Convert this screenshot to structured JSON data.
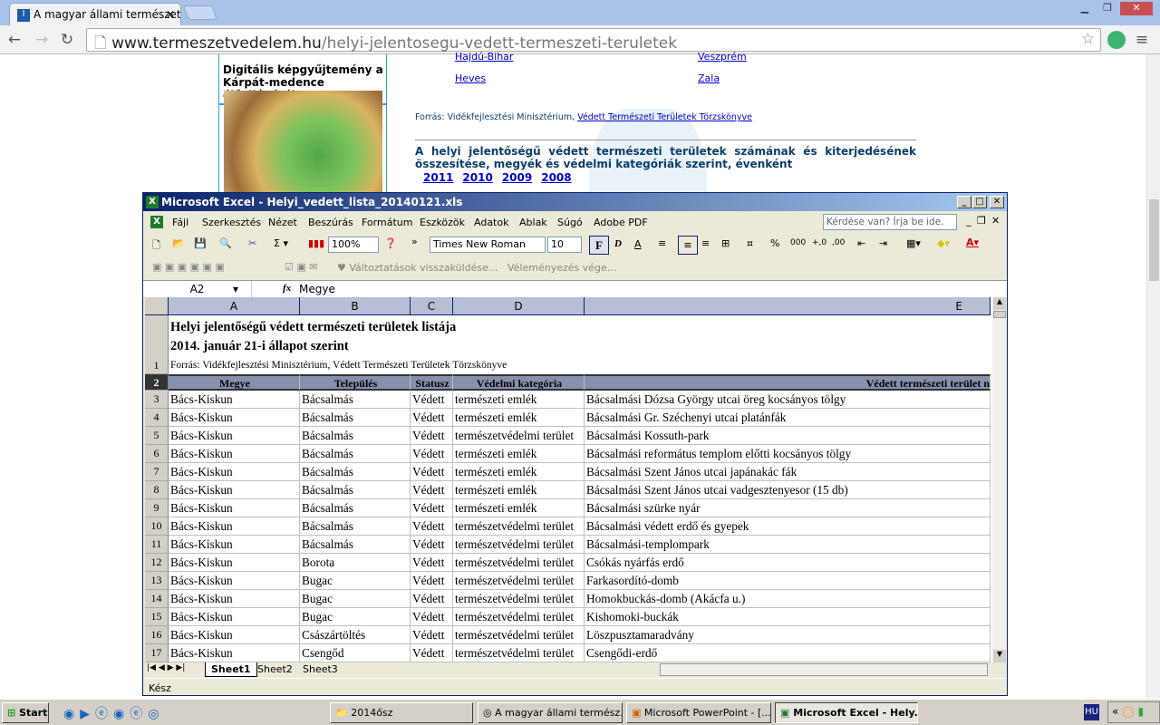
{
  "browser": {
    "tab_title": "A magyar állami természetvé",
    "url_host": "www.termeszetvedelem.hu",
    "url_path": "/helyi-jelentosegu-vedett-termeszeti-teruletek"
  },
  "webpage": {
    "sidebar_title": "Digitális képgyűjtemény a Kárpát-medence élővilágáról",
    "links_left": [
      "Hajdú-Bihar",
      "Heves"
    ],
    "links_right": [
      "Veszprém",
      "Zala"
    ],
    "source_prefix": "Forrás: Vidékfejlesztési Minisztérium,",
    "source_link": "Védett Természeti Területek Törzskönyve",
    "summary_title": "A helyi jelentőségű védett természeti területek számának és kiterjedésének összesítése, megyék és védelmi kategóriák szerint, évenként",
    "years": [
      "2011",
      "2010",
      "2009",
      "2008"
    ]
  },
  "excel": {
    "title": "Microsoft Excel - Helyi_vedett_lista_20140121.xls",
    "menu": [
      "Fájl",
      "Szerkesztés",
      "Nézet",
      "Beszúrás",
      "Formátum",
      "Eszközök",
      "Adatok",
      "Ablak",
      "Súgó",
      "Adobe PDF"
    ],
    "help_placeholder": "Kérdése van? Írja be ide.",
    "zoom": "100%",
    "font": "Times New Roman",
    "font_size": "10",
    "review_send": "Változtatások visszaküldése...",
    "review_end": "Véleményezés vége...",
    "name_box": "A2",
    "fx": "fx",
    "formula": "Megye",
    "columns": [
      "A",
      "B",
      "C",
      "D",
      "E"
    ],
    "row1": [
      "Helyi jelentőségű védett természeti területek listája",
      "2014. január 21-i állapot szerint",
      "Forrás: Vidékfejlesztési Minisztérium, Védett Természeti Területek Törzskönyve"
    ],
    "headers": [
      "Megye",
      "Település",
      "Statusz",
      "Védelmi kategória",
      "Védett természeti terület n"
    ],
    "rows": [
      [
        "3",
        "Bács-Kiskun",
        "Bácsalmás",
        "Védett",
        "természeti emlék",
        "Bácsalmási Dózsa György utcai öreg kocsányos tölgy"
      ],
      [
        "4",
        "Bács-Kiskun",
        "Bácsalmás",
        "Védett",
        "természeti emlék",
        "Bácsalmási Gr. Széchenyi utcai platánfák"
      ],
      [
        "5",
        "Bács-Kiskun",
        "Bácsalmás",
        "Védett",
        "természetvédelmi terület",
        "Bácsalmási Kossuth-park"
      ],
      [
        "6",
        "Bács-Kiskun",
        "Bácsalmás",
        "Védett",
        "természeti emlék",
        "Bácsalmási református templom előtti kocsányos tölgy"
      ],
      [
        "7",
        "Bács-Kiskun",
        "Bácsalmás",
        "Védett",
        "természeti emlék",
        "Bácsalmási Szent János utcai japánakác fák"
      ],
      [
        "8",
        "Bács-Kiskun",
        "Bácsalmás",
        "Védett",
        "természeti emlék",
        "Bácsalmási Szent János utcai vadgesztenyesor (15 db)"
      ],
      [
        "9",
        "Bács-Kiskun",
        "Bácsalmás",
        "Védett",
        "természeti emlék",
        "Bácsalmási szürke nyár"
      ],
      [
        "10",
        "Bács-Kiskun",
        "Bácsalmás",
        "Védett",
        "természetvédelmi terület",
        "Bácsalmási védett erdő és gyepek"
      ],
      [
        "11",
        "Bács-Kiskun",
        "Bácsalmás",
        "Védett",
        "természetvédelmi terület",
        "Bácsalmási-templompark"
      ],
      [
        "12",
        "Bács-Kiskun",
        "Borota",
        "Védett",
        "természetvédelmi terület",
        "Csókás nyárfás erdő"
      ],
      [
        "13",
        "Bács-Kiskun",
        "Bugac",
        "Védett",
        "természetvédelmi terület",
        "Farkasordító-domb"
      ],
      [
        "14",
        "Bács-Kiskun",
        "Bugac",
        "Védett",
        "természetvédelmi terület",
        "Homokbuckás-domb (Akácfa u.)"
      ],
      [
        "15",
        "Bács-Kiskun",
        "Bugac",
        "Védett",
        "természetvédelmi terület",
        "Kishomoki-buckák"
      ],
      [
        "16",
        "Bács-Kiskun",
        "Császártöltés",
        "Védett",
        "természetvédelmi terület",
        "Löszpusztamaradvány"
      ],
      [
        "17",
        "Bács-Kiskun",
        "Csengőd",
        "Védett",
        "természetvédelmi terület",
        "Csengődi-erdő"
      ]
    ],
    "sheets": [
      "Sheet1",
      "Sheet2",
      "Sheet3"
    ],
    "status": "Kész"
  },
  "taskbar": {
    "start": "Start",
    "items": [
      "2014ősz",
      "A magyar állami termész...",
      "Microsoft PowerPoint - [...",
      "Microsoft Excel - Hely..."
    ],
    "lang": "HU"
  }
}
